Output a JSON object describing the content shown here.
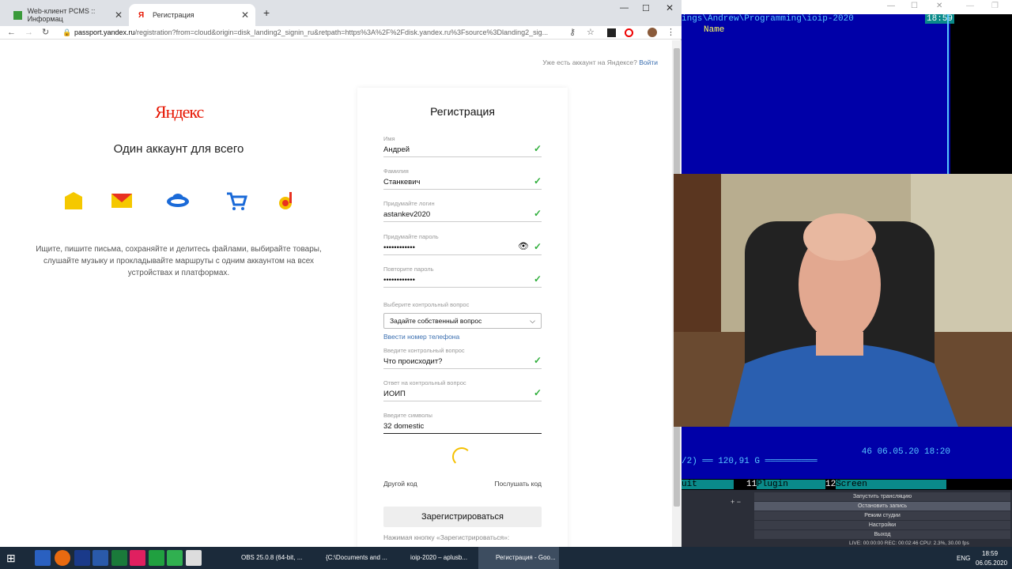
{
  "browser": {
    "tabs": [
      {
        "title": "Web-клиент PCMS :: Информац"
      },
      {
        "title": "Регистрация"
      }
    ],
    "url_host": "passport.yandex.ru",
    "url_rest": "/registration?from=cloud&origin=disk_landing2_signin_ru&retpath=https%3A%2F%2Fdisk.yandex.ru%3Fsource%3Dlanding2_sig..."
  },
  "left": {
    "logo": "Яндекс",
    "slogan": "Один аккаунт для всего",
    "description": "Ищите, пишите письма, сохраняйте и делитесь файлами, выбирайте товары, слушайте музыку и прокладывайте маршруты с одним аккаунтом на всех устройствах и платформах.",
    "have_account": "Уже есть аккаунт на Яндексе?",
    "login_link": "Войти"
  },
  "form": {
    "title": "Регистрация",
    "fields": [
      {
        "label": "Имя",
        "value": "Андрей"
      },
      {
        "label": "Фамилия",
        "value": "Станкевич"
      },
      {
        "label": "Придумайте логин",
        "value": "astankev2020"
      },
      {
        "label": "Придумайте пароль",
        "value": "••••••••••••"
      },
      {
        "label": "Повторите пароль",
        "value": "••••••••••••"
      }
    ],
    "question_label": "Выберите контрольный вопрос",
    "question_selected": "Задайте собственный вопрос",
    "phone_link": "Ввести номер телефона",
    "fields2": [
      {
        "label": "Введите контрольный вопрос",
        "value": "Что происходит?"
      },
      {
        "label": "Ответ на контрольный вопрос",
        "value": "ИОИП"
      },
      {
        "label": "Введите символы",
        "value": "32 domestic"
      }
    ],
    "other_code": "Другой код",
    "listen_code": "Послушать код",
    "register_button": "Зарегистрироваться",
    "note": "Нажимая кнопку «Зарегистрироваться»:"
  },
  "terminal": {
    "path": "ings\\Andrew\\Programming\\ioip-2020",
    "clock": "18:59",
    "name_col": "Name",
    "status_date": "46 06.05.20 18:20",
    "status_free": "/2) ══ 120,91 G ══════════",
    "fkeys": [
      {
        "n": "",
        "l": "uit"
      },
      {
        "n": "11",
        "l": "Plugin"
      },
      {
        "n": "12",
        "l": "Screen"
      }
    ]
  },
  "obs": {
    "buttons": [
      "Запустить трансляцию",
      "Остановить запись",
      "Режим студии",
      "Настройки",
      "Выход"
    ],
    "status": "LIVE: 00:00:00   REC: 00:02:46   CPU: 2.3%, 30.00 fps"
  },
  "taskbar": {
    "buttons": [
      "OBS 25.0.8 (64-bit, ...",
      "{C:\\Documents and ...",
      "ioip-2020 – aplusb...",
      "Регистрация - Goo..."
    ],
    "lang": "ENG",
    "time": "18:59",
    "date": "06.05.2020"
  }
}
